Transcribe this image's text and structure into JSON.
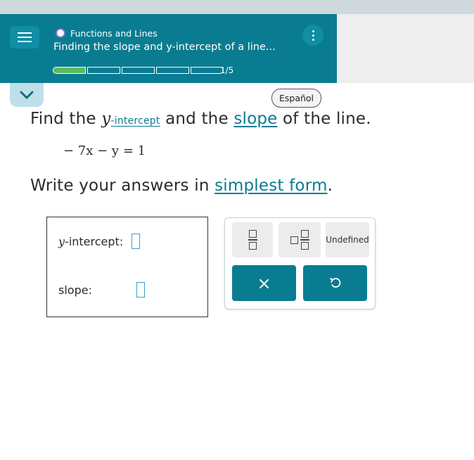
{
  "header": {
    "topic": "Functions and Lines",
    "lesson_title": "Finding the slope and y-intercept of a line...",
    "progress_count": "1/5",
    "progress": {
      "completed": 1,
      "total": 5
    }
  },
  "language_button": "Español",
  "problem": {
    "line1": {
      "pre": "Find the ",
      "var": "y",
      "term1": "-intercept",
      "mid": " and the ",
      "term2": "slope",
      "post": " of the line."
    },
    "equation": "− 7x − y = 1",
    "line2": {
      "pre": "Write your answers in ",
      "term": "simplest form",
      "post": "."
    }
  },
  "answers": {
    "y_intercept_var": "y",
    "y_intercept_label": " -intercept:",
    "slope_label": "slope:",
    "y_intercept_value": "",
    "slope_value": ""
  },
  "keypad": {
    "undefined_label": "Undefined",
    "clear_symbol": "×"
  },
  "colors": {
    "header": "#0a7c91",
    "accent": "#0a7c91",
    "progress_done": "#5cb85c",
    "input_border": "#35a3c4"
  },
  "icons": [
    "hamburger-menu-icon",
    "kebab-menu-icon",
    "chevron-down-icon",
    "undo-icon",
    "fraction-icon",
    "mixed-number-icon",
    "clear-icon"
  ]
}
